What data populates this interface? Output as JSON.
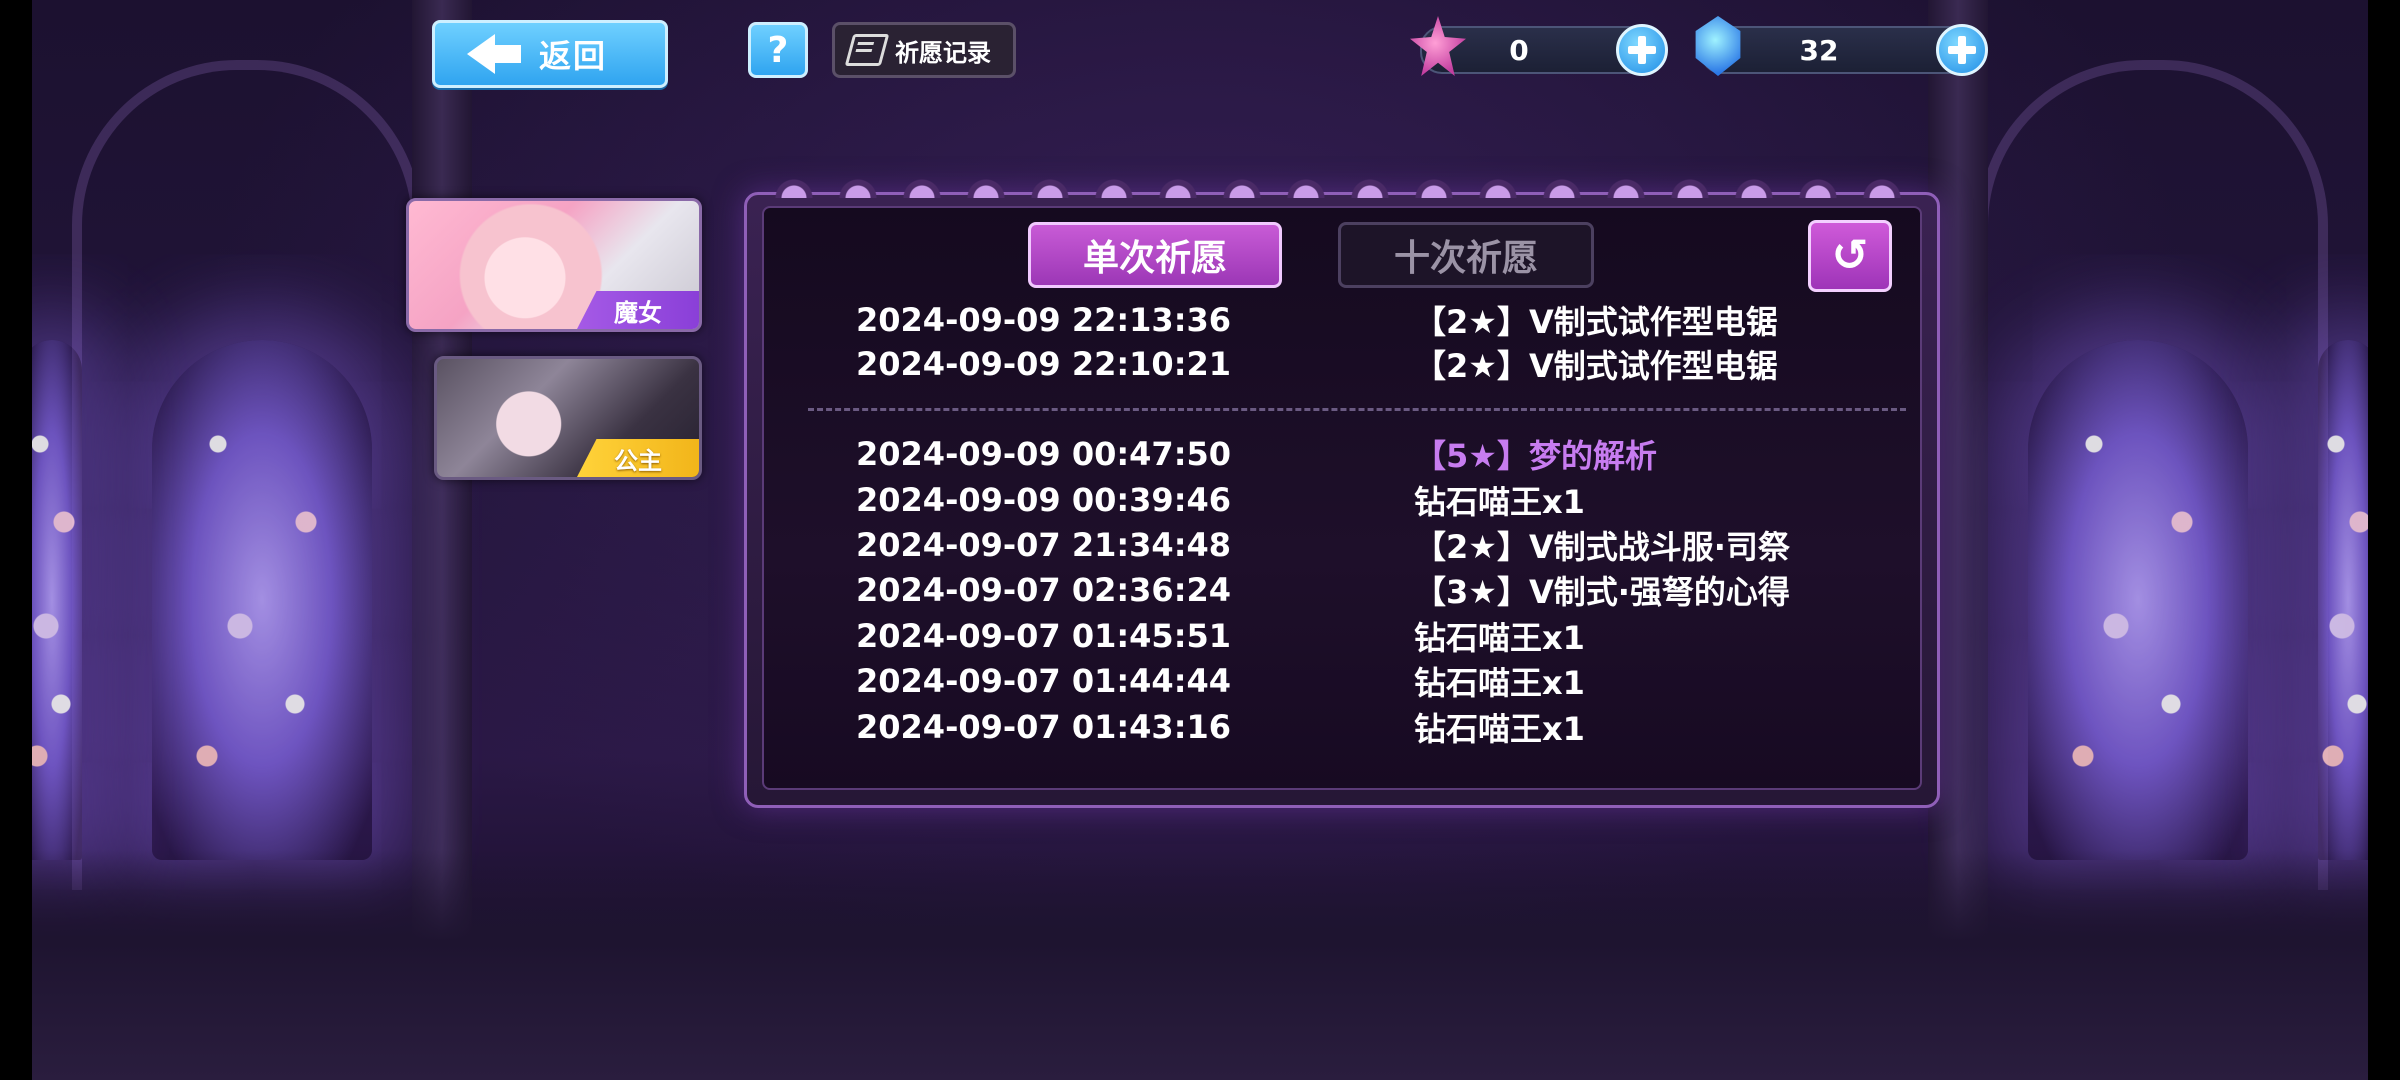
{
  "header": {
    "back_label": "返回",
    "help_label": "?",
    "record_label": "祈愿记录"
  },
  "currencies": [
    {
      "name": "pink-gem",
      "value": "0"
    },
    {
      "name": "blue-crystal",
      "value": "32"
    }
  ],
  "characters": [
    {
      "badge": "魔女"
    },
    {
      "badge": "公主"
    }
  ],
  "tabs": {
    "single": "单次祈愿",
    "ten": "十次祈愿"
  },
  "return_icon": "↺",
  "history_top": [
    {
      "date": "2024-09-09 22:13:36",
      "item": "【2★】V制式试作型电锯"
    },
    {
      "date": "2024-09-09 22:10:21",
      "item": "【2★】V制式试作型电锯"
    }
  ],
  "history": [
    {
      "date": "2024-09-09 00:47:50",
      "item": "【5★】梦的解析",
      "color": "#c77cf0"
    },
    {
      "date": "2024-09-09 00:39:46",
      "item": "钻石喵王x1",
      "color": "#ffffff"
    },
    {
      "date": "2024-09-07 21:34:48",
      "item": "【2★】V制式战斗服·司祭",
      "color": "#ffffff"
    },
    {
      "date": "2024-09-07 02:36:24",
      "item": "【3★】V制式·强弩的心得",
      "color": "#ffffff"
    },
    {
      "date": "2024-09-07 01:45:51",
      "item": "钻石喵王x1",
      "color": "#ffffff"
    },
    {
      "date": "2024-09-07 01:44:44",
      "item": "钻石喵王x1",
      "color": "#ffffff"
    },
    {
      "date": "2024-09-07 01:43:16",
      "item": "钻石喵王x1",
      "color": "#ffffff"
    }
  ]
}
